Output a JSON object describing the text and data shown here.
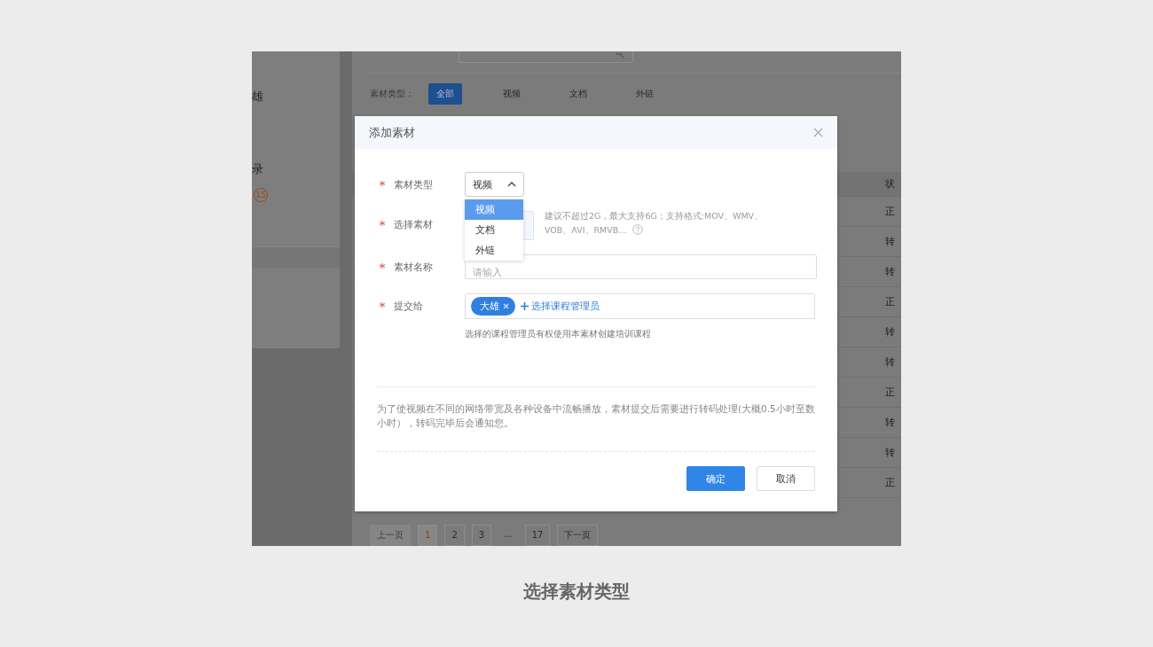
{
  "background_page": {
    "sidebar": {
      "items": [
        {
          "label": "雄"
        },
        {
          "label": "录"
        }
      ],
      "badge": "15"
    },
    "filter": {
      "label": "素材类型：",
      "tabs": [
        {
          "label": "全部",
          "selected": true
        },
        {
          "label": "视频",
          "selected": false
        },
        {
          "label": "文档",
          "selected": false
        },
        {
          "label": "外链",
          "selected": false
        }
      ]
    },
    "table": {
      "header": "状",
      "rows": [
        "正",
        "转",
        "转",
        "正",
        "转",
        "转",
        "正",
        "转",
        "转",
        "正"
      ]
    },
    "pagination": [
      {
        "label": "上一页",
        "kind": "prev",
        "disabled": true,
        "selected": false
      },
      {
        "label": "1",
        "kind": "page",
        "disabled": false,
        "selected": true
      },
      {
        "label": "2",
        "kind": "page",
        "disabled": false,
        "selected": false
      },
      {
        "label": "3",
        "kind": "page",
        "disabled": false,
        "selected": false
      },
      {
        "label": "...",
        "kind": "gap"
      },
      {
        "label": "17",
        "kind": "page",
        "disabled": false,
        "selected": false
      },
      {
        "label": "下一页",
        "kind": "next",
        "disabled": false,
        "selected": false
      }
    ]
  },
  "dialog": {
    "title": "添加素材",
    "fields": [
      {
        "label": "素材类型",
        "required": true,
        "kind": "select",
        "value": "视频",
        "expanded": true,
        "options": [
          {
            "label": "视频",
            "selected": true
          },
          {
            "label": "文档",
            "selected": false
          },
          {
            "label": "外链",
            "selected": false
          }
        ]
      },
      {
        "label": "选择素材",
        "required": true,
        "kind": "upload",
        "hint": "建议不超过2G，最大支持6G；支持格式:MOV、WMV、VOB、AVI、RMVB…"
      },
      {
        "label": "素材名称",
        "required": true,
        "kind": "text",
        "placeholder": "请输入"
      },
      {
        "label": "提交给",
        "required": true,
        "kind": "tags",
        "tags": [
          "大雄"
        ],
        "add_link": "选择课程管理员",
        "help": "选择的课程管理员有权使用本素材创建培训课程"
      }
    ],
    "note": "为了使视频在不同的网络带宽及各种设备中流畅播放，素材提交后需要进行转码处理(大概0.5小时至数小时），转码完毕后会通知您。",
    "buttons": [
      {
        "label": "确定",
        "kind": "primary"
      },
      {
        "label": "取消",
        "kind": "default"
      }
    ]
  },
  "caption": "选择素材类型"
}
